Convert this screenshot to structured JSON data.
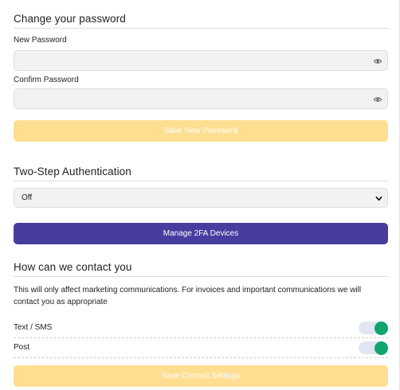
{
  "password_section": {
    "title": "Change your password",
    "new_password_label": "New Password",
    "new_password_value": "",
    "confirm_password_label": "Confirm Password",
    "confirm_password_value": "",
    "show_password_icon": "eye-icon",
    "save_button_label": "Save New Password"
  },
  "two_step_section": {
    "title": "Two-Step Authentication",
    "selected_option": "Off",
    "manage_button_label": "Manage 2FA Devices"
  },
  "contact_section": {
    "title": "How can we contact you",
    "description": "This will only affect marketing communications. For invoices and important communications we will contact you as appropriate",
    "options": [
      {
        "label": "Text / SMS",
        "enabled": true
      },
      {
        "label": "Post",
        "enabled": true
      }
    ],
    "save_button_label": "Save Contact Settings"
  },
  "colors": {
    "primary_button": "#473d9f",
    "disabled_button": "#ffde92",
    "toggle_on": "#0fa56d",
    "toggle_track": "#e1e6f2",
    "input_bg": "#f2f2f4"
  }
}
